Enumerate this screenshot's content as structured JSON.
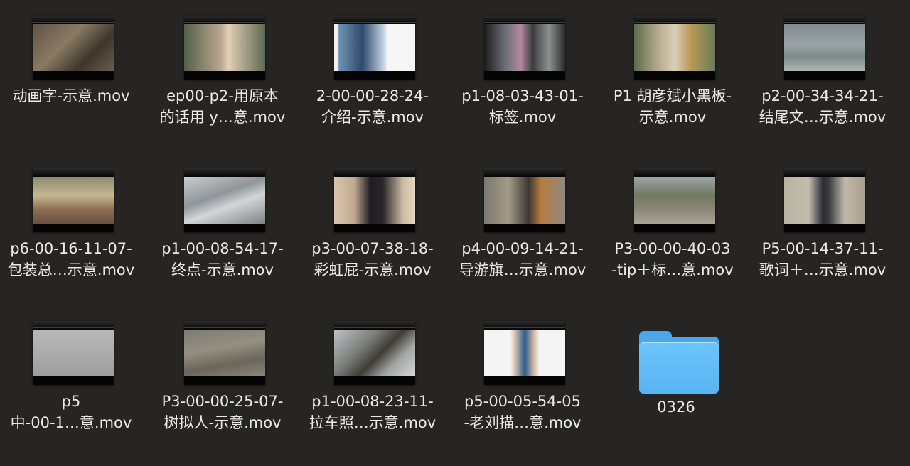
{
  "items": [
    {
      "label": "动画字-示意.mov",
      "kind": "video"
    },
    {
      "label": "ep00-p2-用原本\n的话用 y…意.mov",
      "kind": "video"
    },
    {
      "label": "2-00-00-28-24-\n介绍-示意.mov",
      "kind": "video"
    },
    {
      "label": "p1-08-03-43-01-\n标签.mov",
      "kind": "video"
    },
    {
      "label": "P1 胡彦斌小黑板-\n示意.mov",
      "kind": "video"
    },
    {
      "label": "p2-00-34-34-21-\n结尾文…示意.mov",
      "kind": "video"
    },
    {
      "label": "p6-00-16-11-07-\n包装总…示意.mov",
      "kind": "video"
    },
    {
      "label": "p1-00-08-54-17-\n终点-示意.mov",
      "kind": "video"
    },
    {
      "label": "p3-00-07-38-18-\n彩虹屁-示意.mov",
      "kind": "video"
    },
    {
      "label": "p4-00-09-14-21-\n导游旗…示意.mov",
      "kind": "video"
    },
    {
      "label": "P3-00-00-40-03\n-tip＋标…意.mov",
      "kind": "video"
    },
    {
      "label": "P5-00-14-37-11-\n歌词＋…示意.mov",
      "kind": "video"
    },
    {
      "label": "p5\n中-00-1…意.mov",
      "kind": "video"
    },
    {
      "label": "P3-00-00-25-07-\n树拟人-示意.mov",
      "kind": "video"
    },
    {
      "label": "p1-00-08-23-11-\n拉车照…示意.mov",
      "kind": "video"
    },
    {
      "label": "p5-00-05-54-05\n-老刘描…意.mov",
      "kind": "video"
    },
    {
      "label": "0326",
      "kind": "folder",
      "icon": "folder-icon"
    }
  ],
  "colors": {
    "background": "#262523",
    "label": "#eaeaea",
    "folder": "#5ab6f3"
  }
}
